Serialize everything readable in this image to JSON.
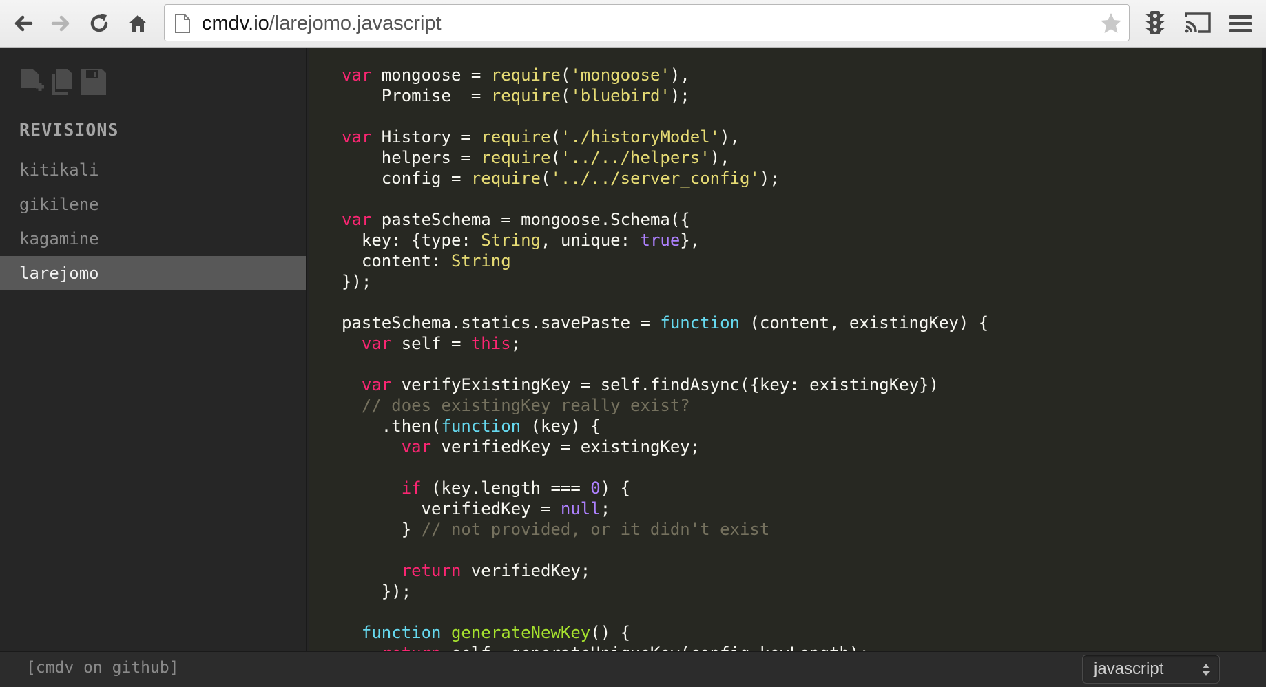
{
  "browser": {
    "url_host": "cmdv.io",
    "url_path": "/larejomo.javascript"
  },
  "sidebar": {
    "title": "REVISIONS",
    "items": [
      {
        "label": "kitikali"
      },
      {
        "label": "gikilene"
      },
      {
        "label": "kagamine"
      },
      {
        "label": "larejomo"
      }
    ],
    "active_item": "larejomo"
  },
  "editor": {
    "language": "javascript",
    "lines": [
      "var mongoose = require('mongoose'),",
      "    Promise  = require('bluebird');",
      "",
      "var History = require('./historyModel'),",
      "    helpers = require('../../helpers'),",
      "    config = require('../../server_config');",
      "",
      "var pasteSchema = mongoose.Schema({",
      "  key: {type: String, unique: true},",
      "  content: String",
      "});",
      "",
      "pasteSchema.statics.savePaste = function (content, existingKey) {",
      "  var self = this;",
      "",
      "  var verifyExistingKey = self.findAsync({key: existingKey})",
      "  // does existingKey really exist?",
      "    .then(function (key) {",
      "      var verifiedKey = existingKey;",
      "",
      "      if (key.length === 0) {",
      "        verifiedKey = null;",
      "      } // not provided, or it didn't exist",
      "",
      "      return verifiedKey;",
      "    });",
      "",
      "  function generateNewKey() {",
      "    return self._generateUniqueKey(config.keyLength);"
    ]
  },
  "footer": {
    "github_link": "[cmdv on github]",
    "language_select": "javascript"
  },
  "colors": {
    "keyword": "#f92672",
    "function_keyword": "#66d9ef",
    "string": "#e6db74",
    "boolean_number": "#ae81ff",
    "comment": "#75715e",
    "function_name": "#a6e22e",
    "text": "#f8f8f2",
    "active_revision_bg": "#585858"
  },
  "icons": {
    "back": "back-arrow-icon",
    "forward": "forward-arrow-icon",
    "reload": "reload-icon",
    "home": "home-icon",
    "bookmark": "star-icon",
    "extension": "traffic-light-icon",
    "cast": "cast-icon",
    "menu": "hamburger-menu-icon",
    "new_file": "new-file-icon",
    "duplicate": "duplicate-icon",
    "save": "save-icon"
  }
}
